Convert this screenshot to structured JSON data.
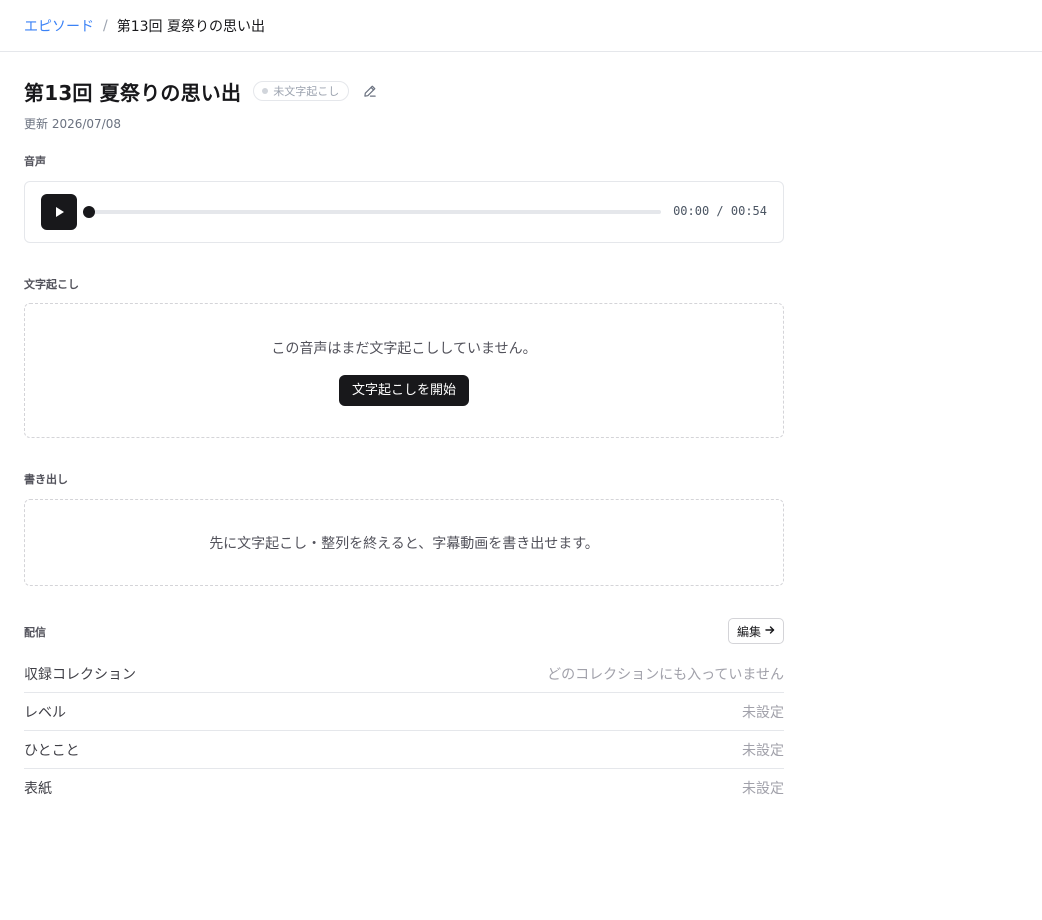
{
  "breadcrumb": {
    "parent": "エピソード",
    "separator": "/",
    "current": "第13回 夏祭りの思い出"
  },
  "episode": {
    "title": "第13回 夏祭りの思い出",
    "status": "未文字起こし",
    "updated": "更新 2026/07/08"
  },
  "audio": {
    "section_label": "音声",
    "time_readout": "00:00 / 00:54",
    "progress": 0
  },
  "transcription": {
    "section_label": "文字起こし",
    "empty_message": "この音声はまだ文字起こししていません。",
    "start_button": "文字起こしを開始"
  },
  "export": {
    "section_label": "書き出し",
    "message": "先に文字起こし・整列を終えると、字幕動画を書き出せます。"
  },
  "distribution": {
    "section_label": "配信",
    "edit_button": "編集",
    "rows": [
      {
        "label": "収録コレクション",
        "value": "どのコレクションにも入っていません"
      },
      {
        "label": "レベル",
        "value": "未設定"
      },
      {
        "label": "ひとこと",
        "value": "未設定"
      },
      {
        "label": "表紙",
        "value": "未設定"
      }
    ]
  },
  "icons": {
    "edit": "pencil-icon",
    "play": "play-icon",
    "arrow": "arrow-right-icon"
  }
}
